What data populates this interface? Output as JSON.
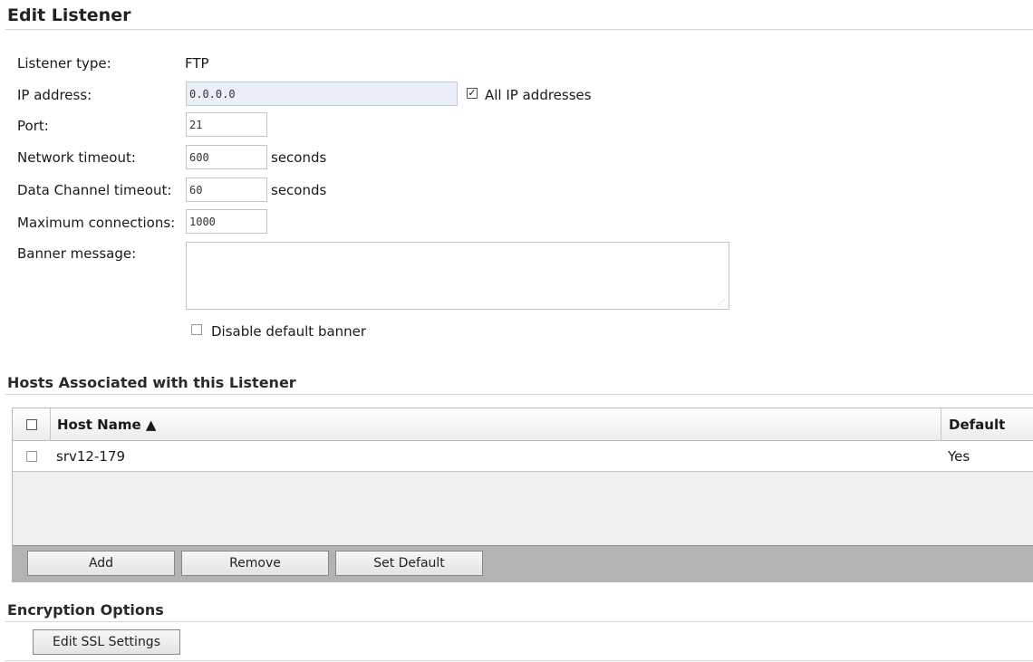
{
  "page": {
    "title": "Edit Listener"
  },
  "form": {
    "listener_type_label": "Listener type:",
    "listener_type_value": "FTP",
    "ip_label": "IP address:",
    "ip_value": "0.0.0.0",
    "all_ip_label": "All IP addresses",
    "all_ip_checked": true,
    "port_label": "Port:",
    "port_value": "21",
    "network_timeout_label": "Network timeout:",
    "network_timeout_value": "600",
    "network_timeout_unit": "seconds",
    "data_timeout_label": "Data Channel timeout:",
    "data_timeout_value": "60",
    "data_timeout_unit": "seconds",
    "max_conn_label": "Maximum connections:",
    "max_conn_value": "1000",
    "banner_label": "Banner message:",
    "banner_value": "",
    "disable_banner_label": "Disable default banner",
    "disable_banner_checked": false
  },
  "hosts": {
    "title": "Hosts Associated with this Listener",
    "columns": {
      "host_name": "Host Name ▲",
      "default": "Default"
    },
    "rows": [
      {
        "host_name": "srv12-179",
        "default": "Yes",
        "checked": false
      }
    ],
    "buttons": {
      "add": "Add",
      "remove": "Remove",
      "set_default": "Set Default"
    }
  },
  "encryption": {
    "title": "Encryption Options",
    "edit_ssl_label": "Edit SSL Settings"
  },
  "icons": {
    "checkbox_checked": "check-icon",
    "sort": "sort-ascending-icon",
    "resize": "resize-grip-icon"
  }
}
